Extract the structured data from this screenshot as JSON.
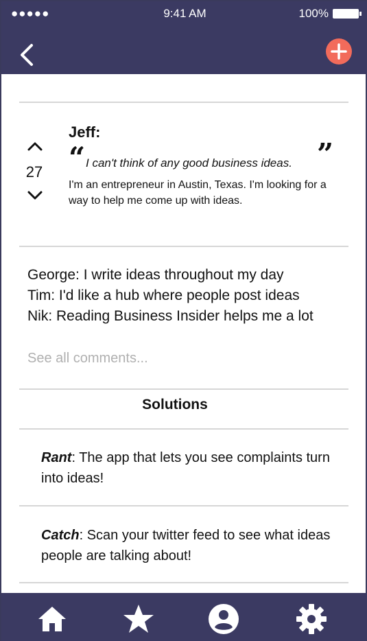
{
  "status_bar": {
    "signal": "●●●●● ",
    "time": "9:41 AM",
    "battery": "100%"
  },
  "header": {
    "back_icon": "chevron-left-icon",
    "add_icon": "plus-circle-icon",
    "add_color": "#f26b5b",
    "bar_color": "#3b3a62"
  },
  "post": {
    "votes": "27",
    "author": "Jeff:",
    "quote_open": "“",
    "quote": "I can't think of any good business ideas.",
    "quote_close": "”",
    "body": "I'm an entrepreneur in Austin, Texas. I'm looking for a way to help me come up with ideas."
  },
  "comments": {
    "items": [
      "George: I write ideas throughout my day",
      "Tim: I'd like a hub where people post ideas",
      "Nik: Reading Business Insider helps me a lot"
    ],
    "see_all": "See all comments..."
  },
  "solutions": {
    "title": "Solutions",
    "items": [
      {
        "name": "Rant",
        "text": ": The app that lets you see complaints turn into ideas!"
      },
      {
        "name": "Catch",
        "text": ": Scan your twitter feed to see what ideas people are talking about!"
      }
    ]
  },
  "tab_bar": {
    "items": [
      "home-icon",
      "star-icon",
      "profile-icon",
      "gear-icon"
    ]
  }
}
